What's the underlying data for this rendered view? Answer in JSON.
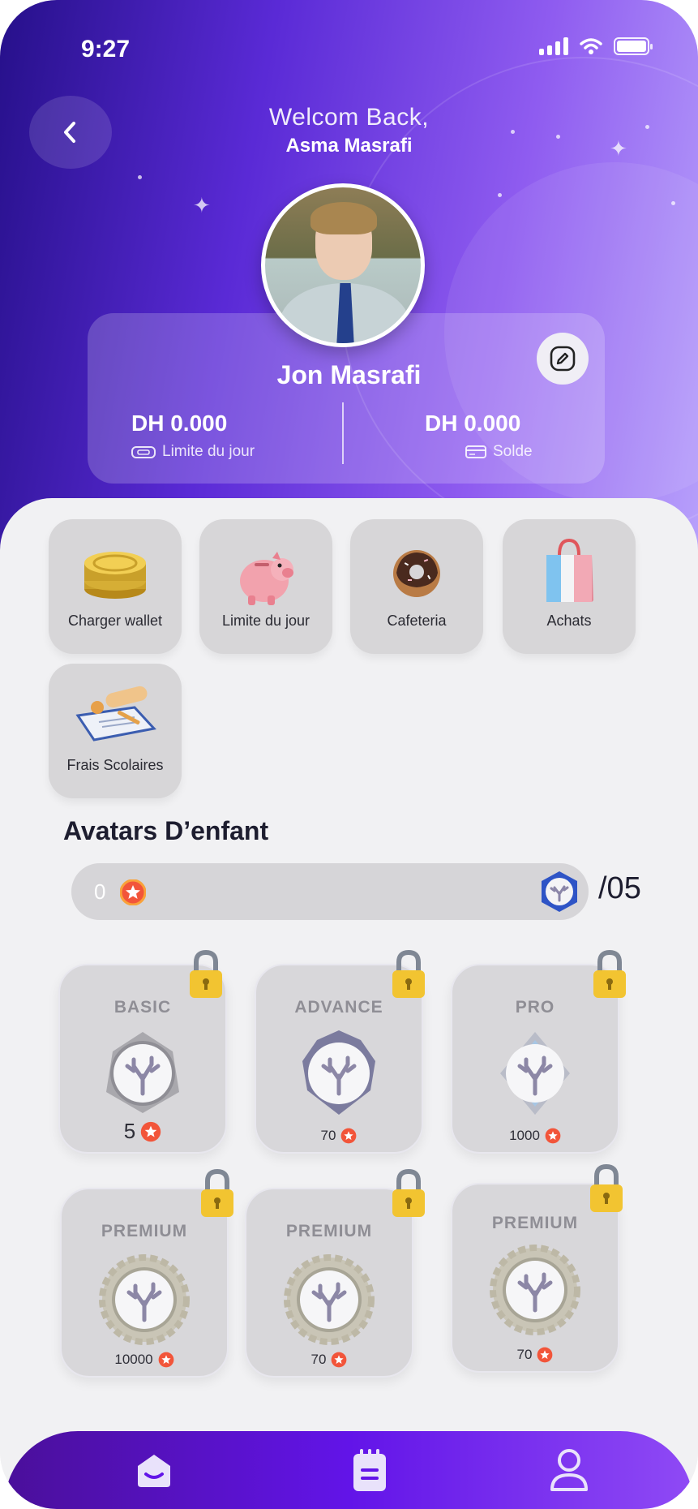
{
  "status_bar": {
    "time": "9:27"
  },
  "header": {
    "welcome_line": "Welcom Back,",
    "parent_name": "Asma Masrafi",
    "child_name": "Jon Masrafi",
    "daily_limit": {
      "amount": "DH 0.000",
      "label": "Limite du jour"
    },
    "balance": {
      "amount": "DH 0.000",
      "label": "Solde"
    }
  },
  "actions": [
    {
      "label": "Charger wallet",
      "icon": "coins-icon"
    },
    {
      "label": "Limite du jour",
      "icon": "piggy-bank-icon"
    },
    {
      "label": "Cafeteria",
      "icon": "donut-icon"
    },
    {
      "label": "Achats",
      "icon": "shopping-bag-icon"
    },
    {
      "label": "Frais Scolaires",
      "icon": "school-fees-icon"
    }
  ],
  "avatars": {
    "title": "Avatars D’enfant",
    "points": "0",
    "max": "/05",
    "levels": [
      {
        "title": "BASIC",
        "price": "5",
        "locked": true
      },
      {
        "title": "ADVANCE",
        "price": "70",
        "locked": true
      },
      {
        "title": "PRO",
        "price": "1000",
        "locked": true
      },
      {
        "title": "PREMIUM",
        "price": "10000",
        "locked": true
      },
      {
        "title": "PREMIUM",
        "price": "70",
        "locked": true
      },
      {
        "title": "PREMIUM",
        "price": "70",
        "locked": true
      }
    ]
  },
  "tabbar": {
    "items": [
      "home-icon",
      "notes-icon",
      "profile-icon"
    ]
  },
  "colors": {
    "accent": "#6214e8",
    "header_start": "#26108a",
    "header_end": "#b7a0fb",
    "star": "#f2553a"
  }
}
